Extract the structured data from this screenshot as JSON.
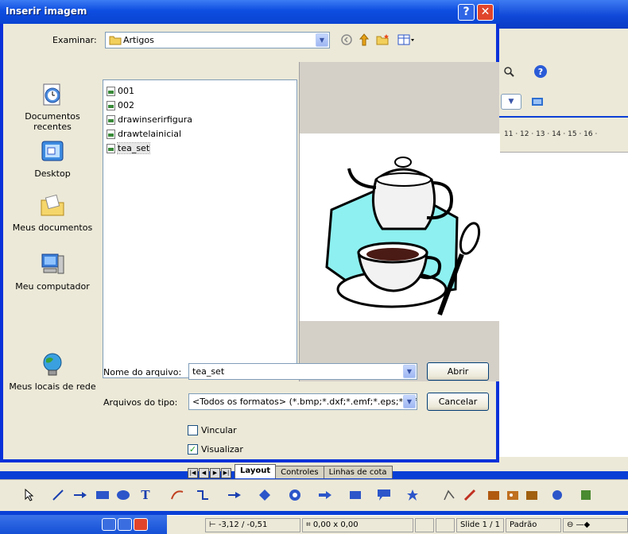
{
  "dialog": {
    "title": "Inserir imagem",
    "look_in_label": "Examinar:",
    "look_in_value": "Artigos",
    "places": [
      {
        "label": "Documentos recentes"
      },
      {
        "label": "Desktop"
      },
      {
        "label": "Meus documentos"
      },
      {
        "label": "Meu computador"
      },
      {
        "label": "Meus locais de rede"
      }
    ],
    "files": [
      "001",
      "002",
      "drawinserirfigura",
      "drawtelainicial",
      "tea_set"
    ],
    "selected_file": "tea_set",
    "filename_label": "Nome do arquivo:",
    "filename_value": "tea_set",
    "filetype_label": "Arquivos do tipo:",
    "filetype_value": "<Todos os formatos> (*.bmp;*.dxf;*.emf;*.eps;*.gif;*.",
    "open_button": "Abrir",
    "cancel_button": "Cancelar",
    "link_checkbox": {
      "label": "Vincular",
      "checked": false
    },
    "preview_checkbox": {
      "label": "Visualizar",
      "checked": true
    },
    "help_glyph": "?",
    "close_glyph": "✕"
  },
  "app": {
    "ruler_text": "11 · 12 · 13 · 14 · 15 · 16 ·",
    "tabs": [
      "Layout",
      "Controles",
      "Linhas de cota"
    ],
    "active_tab": "Layout",
    "status": {
      "position": "-3,12 / -0,51",
      "size": "0,00 x 0,00",
      "slide": "Slide 1 / 1",
      "layout": "Padrão"
    }
  },
  "colors": {
    "title_bar": "#0d4de0",
    "dialog_face": "#ece9d8",
    "close_button": "#e0452b",
    "preview_cyan": "#8ef0f0"
  }
}
